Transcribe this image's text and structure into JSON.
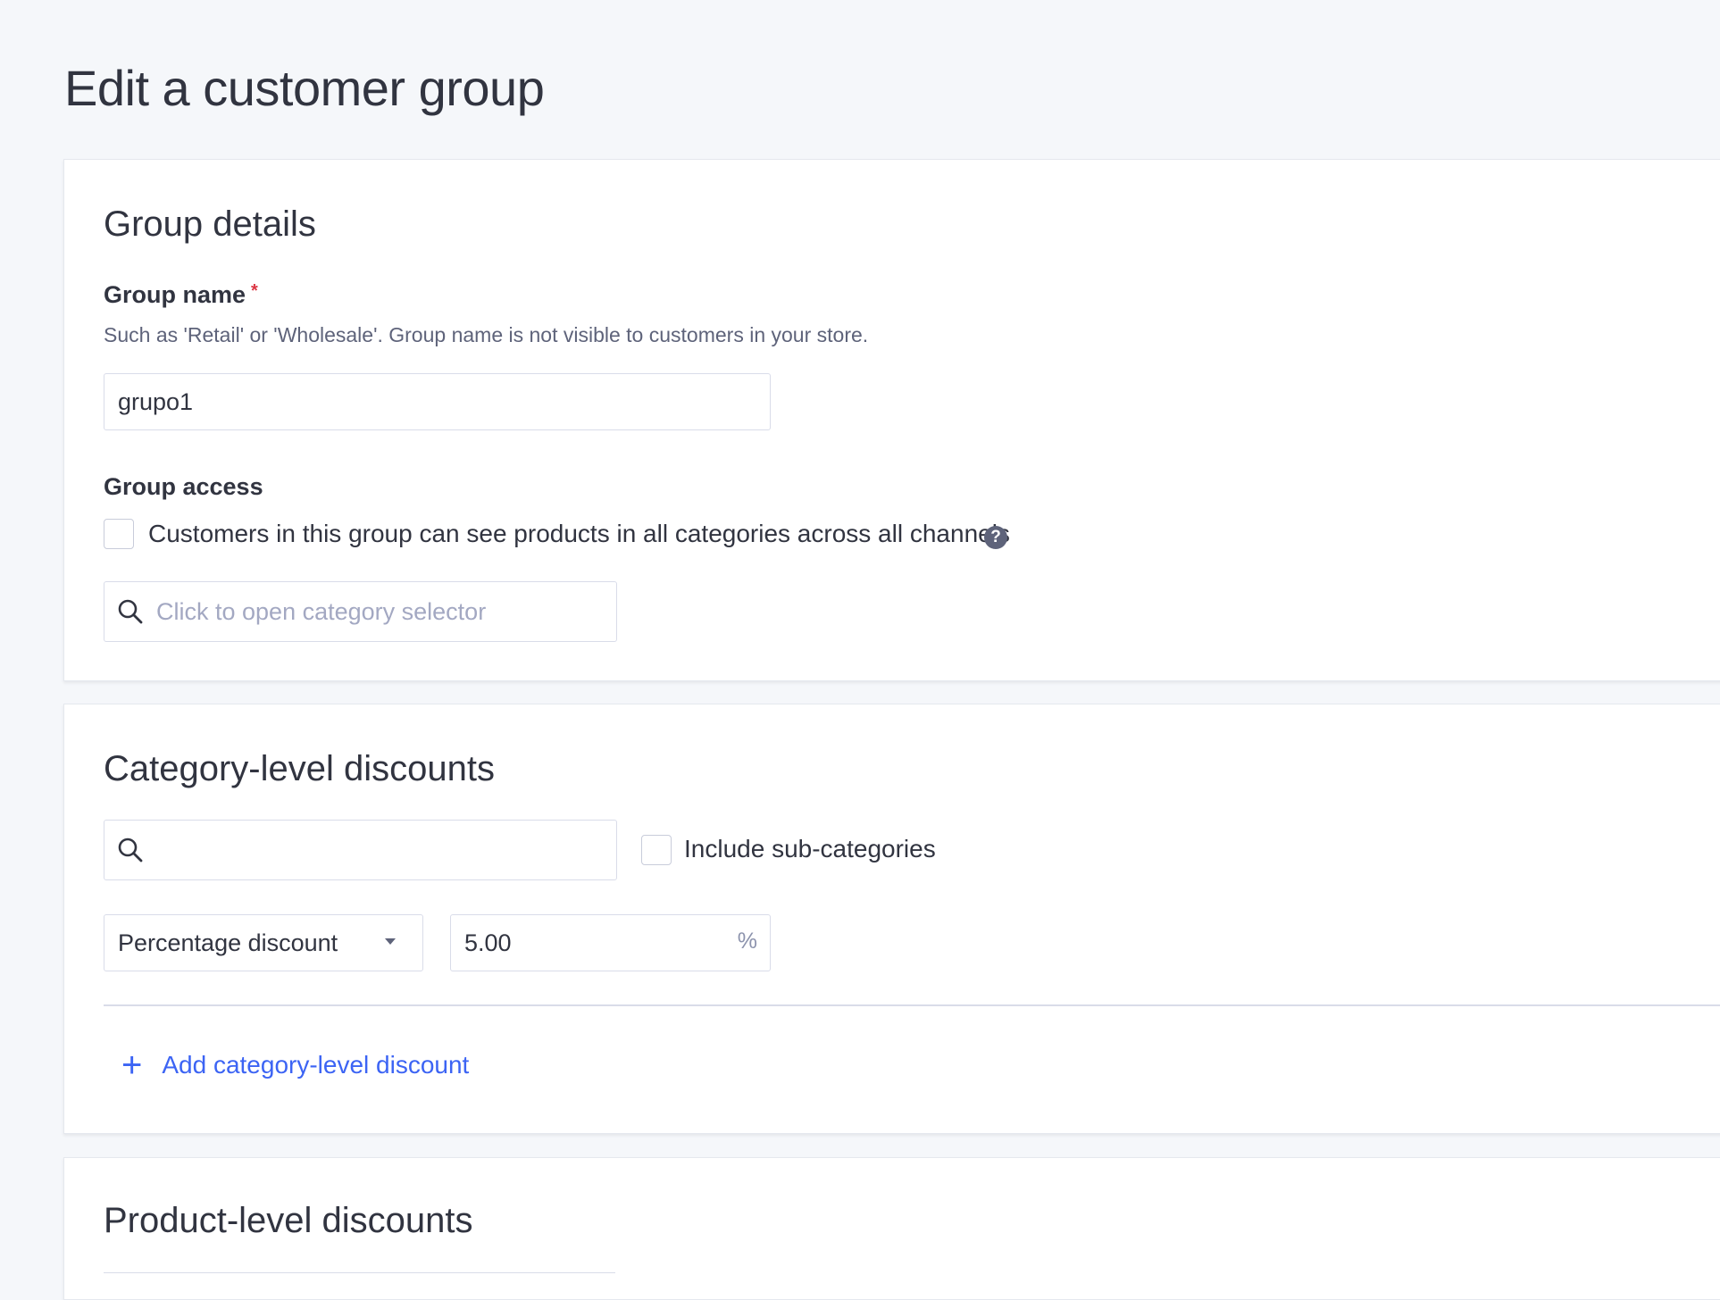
{
  "page": {
    "title": "Edit a customer group"
  },
  "group_details": {
    "title": "Group details",
    "group_name": {
      "label": "Group name",
      "required_mark": "*",
      "hint": "Such as 'Retail' or 'Wholesale'. Group name is not visible to customers in your store.",
      "value": "grupo1"
    },
    "group_access": {
      "label": "Group access",
      "checkbox_label": "Customers in this group can see products in all categories across all channels",
      "checked": false,
      "help_glyph": "?",
      "category_selector_placeholder": "Click to open category selector"
    }
  },
  "category_discounts": {
    "title": "Category-level discounts",
    "search_value": "",
    "include_subcategories_label": "Include sub-categories",
    "include_subcategories_checked": false,
    "discount_type": "Percentage discount",
    "discount_value": "5.00",
    "discount_suffix": "%",
    "add_link_label": "Add category-level discount",
    "add_link_glyph": "+"
  },
  "product_discounts": {
    "title": "Product-level discounts"
  },
  "colors": {
    "background": "#f5f7fa",
    "card": "#ffffff",
    "text": "#313440",
    "hint": "#5e637a",
    "placeholder": "#a3a8c2",
    "border": "#d9dce9",
    "link": "#3c64f4",
    "required": "#db3643"
  },
  "icons": [
    "search-icon",
    "help-icon",
    "plus-icon",
    "caret-down-icon"
  ]
}
